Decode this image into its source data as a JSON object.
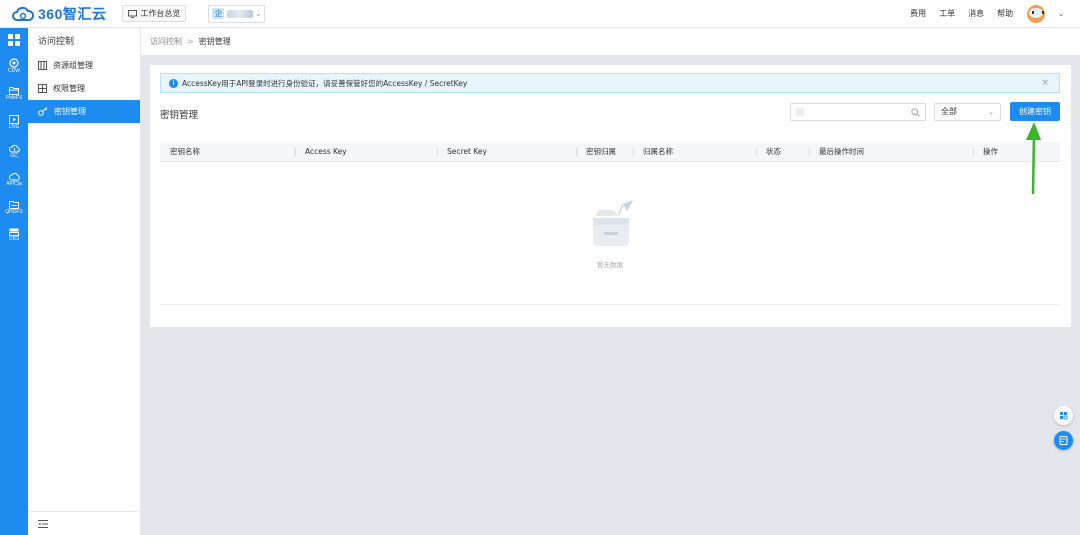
{
  "brand": {
    "name": "360智汇云"
  },
  "topbar": {
    "workbench_label": "工作台总览",
    "project_badge": "企",
    "nav": [
      "费用",
      "工单",
      "消息",
      "帮助"
    ]
  },
  "rail": {
    "items": [
      {
        "label": "",
        "icon": "grid-icon"
      },
      {
        "label": "CDW",
        "icon": "database-icon"
      },
      {
        "label": "PoleFS",
        "icon": "folder-icon"
      },
      {
        "label": "LIVE",
        "icon": "play-icon"
      },
      {
        "label": "GC",
        "icon": "cloud-icon"
      },
      {
        "label": "APICla",
        "icon": "api-cloud-icon"
      },
      {
        "label": "QHDFS",
        "icon": "hdfs-folder-icon"
      },
      {
        "label": "OBS",
        "icon": "storage-icon"
      }
    ]
  },
  "sidebar": {
    "title": "访问控制",
    "items": [
      {
        "label": "资源组管理",
        "icon": "resource-group-icon"
      },
      {
        "label": "权限管理",
        "icon": "permission-icon"
      },
      {
        "label": "密钥管理",
        "icon": "key-icon",
        "active": true
      }
    ]
  },
  "breadcrumb": {
    "parent": "访问控制",
    "separator": ">",
    "current": "密钥管理"
  },
  "notice": {
    "text": "AccessKey用于API登录时进行身份验证，请妥善保管好您的AccessKey / SecretKey",
    "close": "×"
  },
  "main": {
    "title": "密钥管理",
    "status_filter": "全部",
    "create_button": "创建密钥"
  },
  "table": {
    "columns": [
      "密钥名称",
      "Access Key",
      "Secret Key",
      "密钥归属",
      "归属名称",
      "状态",
      "最后操作时间",
      "操作"
    ],
    "rows": [],
    "empty_text": "暂无数据"
  },
  "colors": {
    "primary": "#1e8bf0",
    "annotation_arrow": "#3bb52a"
  }
}
